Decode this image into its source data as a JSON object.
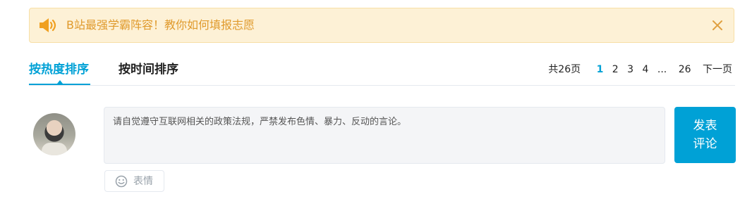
{
  "notice": {
    "text": "B站最强学霸阵容！教你如何填报志愿",
    "icon": "speaker-icon",
    "close_icon": "close-icon",
    "color": "#e09a2c"
  },
  "sort_tabs": {
    "items": [
      {
        "label": "按热度排序",
        "active": true
      },
      {
        "label": "按时间排序",
        "active": false
      }
    ],
    "accent": "#00a1d6"
  },
  "pagination": {
    "total": "共26页",
    "pages": [
      "1",
      "2",
      "3",
      "4"
    ],
    "current": "1",
    "ellipsis": "...",
    "last": "26",
    "next": "下一页"
  },
  "composer": {
    "avatar": "user-avatar",
    "placeholder": "请自觉遵守互联网相关的政策法规，严禁发布色情、暴力、反动的言论。",
    "submit_label": "发表评论",
    "emoji_label": "表情",
    "emoji_icon": "smile-icon"
  }
}
